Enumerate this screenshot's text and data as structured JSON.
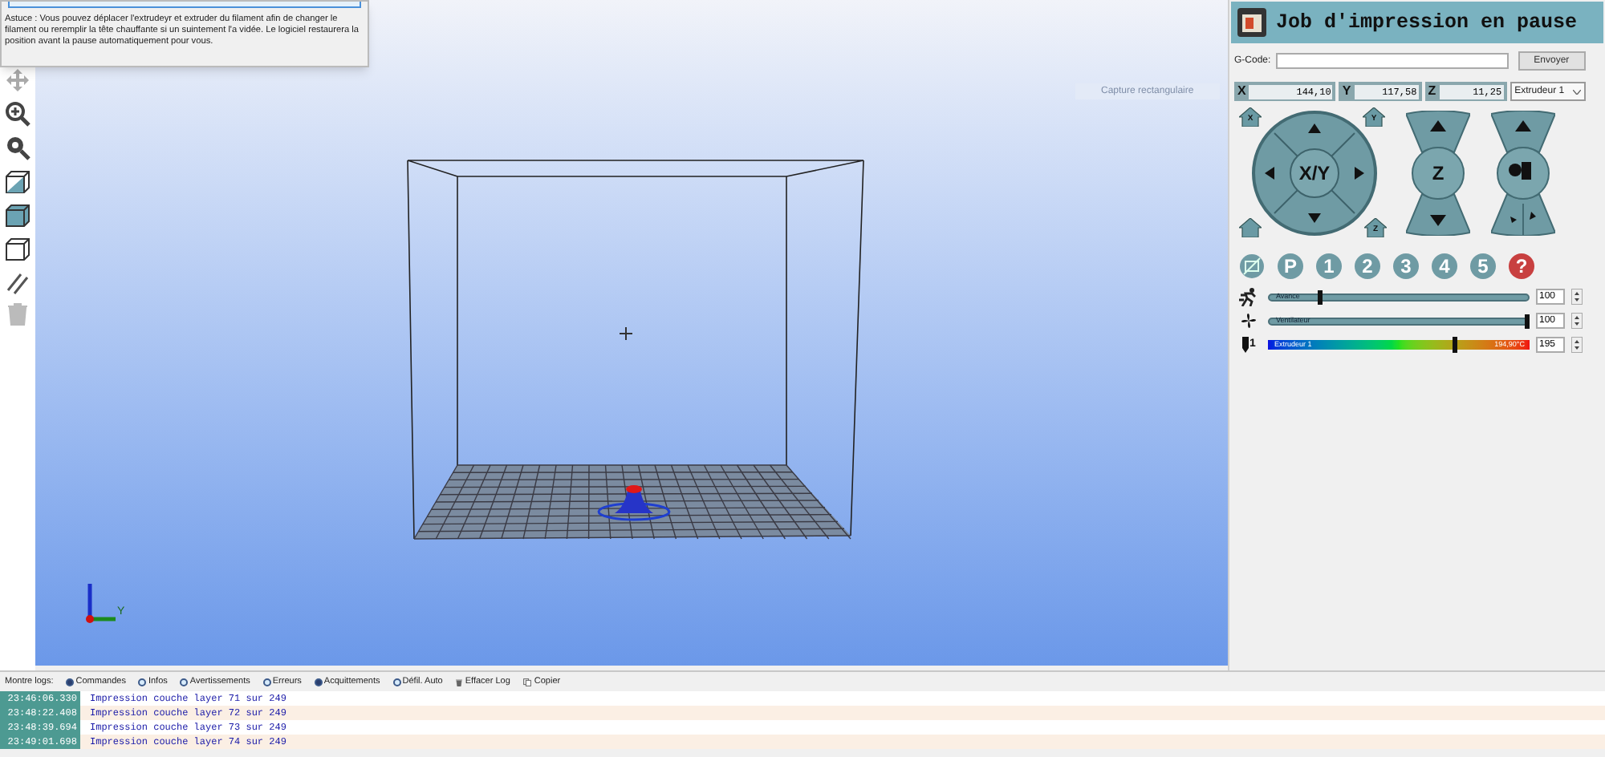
{
  "popup": {
    "tip": "Astuce : Vous pouvez déplacer l'extrudeyr et extruder du filament afin de changer le filament ou reremplir la tête chauffante si un suintement l'a vidée. Le logiciel restaurera la position avant la pause automatiquement pour vous."
  },
  "overlay_label": "Capture rectangulaire",
  "axis_label": "Y",
  "panel": {
    "title": "Job d'impression en pause",
    "gcode_label": "G-Code:",
    "send_button": "Envoyer",
    "coords": [
      {
        "axis": "X",
        "value": "144,10"
      },
      {
        "axis": "Y",
        "value": "117,58"
      },
      {
        "axis": "Z",
        "value": "11,25"
      }
    ],
    "extruder_select": "Extrudeur 1",
    "home_labels": [
      "X",
      "Y",
      "Z"
    ],
    "xy_label": "X/Y",
    "z_label": "Z",
    "quick_buttons": [
      {
        "label": "P",
        "kind": "round"
      },
      {
        "label": "1",
        "kind": "round"
      },
      {
        "label": "2",
        "kind": "round"
      },
      {
        "label": "3",
        "kind": "round"
      },
      {
        "label": "4",
        "kind": "round"
      },
      {
        "label": "5",
        "kind": "round"
      },
      {
        "label": "?",
        "kind": "help"
      }
    ],
    "sliders": [
      {
        "kind": "speed",
        "label": "Avance",
        "level": 0.2,
        "value": "100"
      },
      {
        "kind": "fan",
        "label": "Ventilateur",
        "level": 1.0,
        "value": "100"
      }
    ],
    "temperature": {
      "index": "1",
      "label": "Extrudeur 1",
      "reading": "194,90°C",
      "level": 0.72,
      "value": "195"
    }
  },
  "log": {
    "label": "Montre logs:",
    "filters": [
      {
        "label": "Commandes",
        "on": true
      },
      {
        "label": "Infos",
        "on": false
      },
      {
        "label": "Avertissements",
        "on": false
      },
      {
        "label": "Erreurs",
        "on": false
      },
      {
        "label": "Acquittements",
        "on": true
      },
      {
        "label": "Défil. Auto",
        "on": false
      }
    ],
    "clear_button": "Effacer Log",
    "copy_button": "Copier",
    "entries": [
      {
        "time": "23:46:06.330",
        "text": "Impression couche layer 71 sur 249"
      },
      {
        "time": "23:48:22.408",
        "text": "Impression couche layer 72 sur 249"
      },
      {
        "time": "23:48:39.694",
        "text": "Impression couche layer 73 sur 249"
      },
      {
        "time": "23:49:01.698",
        "text": "Impression couche layer 74 sur 249"
      }
    ]
  }
}
